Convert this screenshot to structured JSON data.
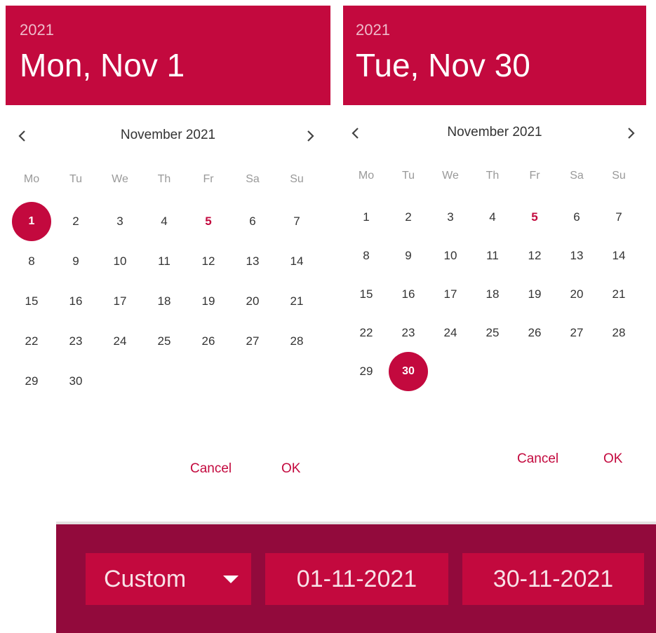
{
  "left_picker": {
    "year": "2021",
    "date_title": "Mon, Nov 1",
    "month_label": "November 2021",
    "weekdays": [
      "Mo",
      "Tu",
      "We",
      "Th",
      "Fr",
      "Sa",
      "Su"
    ],
    "weeks": [
      [
        "1",
        "2",
        "3",
        "4",
        "5",
        "6",
        "7"
      ],
      [
        "8",
        "9",
        "10",
        "11",
        "12",
        "13",
        "14"
      ],
      [
        "15",
        "16",
        "17",
        "18",
        "19",
        "20",
        "21"
      ],
      [
        "22",
        "23",
        "24",
        "25",
        "26",
        "27",
        "28"
      ],
      [
        "29",
        "30"
      ]
    ],
    "selected_day": "1",
    "today_day": "5",
    "cancel_label": "Cancel",
    "ok_label": "OK"
  },
  "right_picker": {
    "year": "2021",
    "date_title": "Tue, Nov 30",
    "month_label": "November 2021",
    "weekdays": [
      "Mo",
      "Tu",
      "We",
      "Th",
      "Fr",
      "Sa",
      "Su"
    ],
    "weeks": [
      [
        "1",
        "2",
        "3",
        "4",
        "5",
        "6",
        "7"
      ],
      [
        "8",
        "9",
        "10",
        "11",
        "12",
        "13",
        "14"
      ],
      [
        "15",
        "16",
        "17",
        "18",
        "19",
        "20",
        "21"
      ],
      [
        "22",
        "23",
        "24",
        "25",
        "26",
        "27",
        "28"
      ],
      [
        "29",
        "30"
      ]
    ],
    "selected_day": "30",
    "today_day": "5",
    "cancel_label": "Cancel",
    "ok_label": "OK"
  },
  "filter_bar": {
    "range_select_value": "Custom",
    "start_date_value": "01-11-2021",
    "end_date_value": "30-11-2021"
  },
  "icons": {
    "prev": "chevron-left-icon",
    "next": "chevron-right-icon",
    "dropdown": "caret-down-icon"
  },
  "colors": {
    "accent": "#c3093e",
    "bar_background": "#920a3c",
    "text": "#333333",
    "weekday_text": "#999999"
  }
}
